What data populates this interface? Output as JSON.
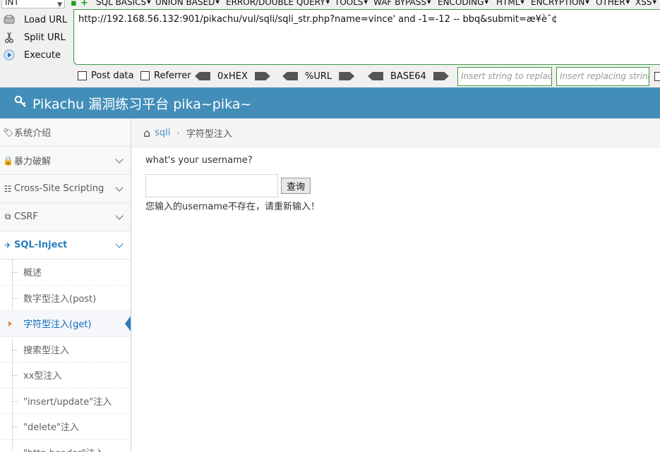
{
  "hackbar": {
    "select_value": "INT",
    "plus_icon": "+",
    "menu": [
      "SQL BASICS",
      "UNION BASED",
      "ERROR/DOUBLE QUERY",
      "TOOLS",
      "WAF BYPASS",
      "ENCODING",
      "HTML",
      "ENCRYPTION",
      "OTHER",
      "XSS"
    ],
    "actions": {
      "load_url": "Load URL",
      "split_url": "Split URL",
      "execute": "Execute"
    },
    "url": "http://192.168.56.132:901/pikachu/vul/sqli/sqli_str.php?name=vince' and -1=-12 -- bbq&submit=æ¥è¯¢",
    "post_data": "Post data",
    "referrer": "Referrer",
    "encoders": [
      "0xHEX",
      "%URL",
      "BASE64"
    ],
    "insert_string_placeholder": "Insert string to replace",
    "insert_replacing_placeholder": "Insert replacing string"
  },
  "site": {
    "title": "Pikachu 漏洞练习平台 pika~pika~"
  },
  "sidebar": {
    "items": [
      {
        "label": "系统介绍",
        "icon": "tag-icon",
        "glyph": "🏷",
        "has_chevron": false
      },
      {
        "label": "暴力破解",
        "icon": "lock-icon",
        "glyph": "🔒",
        "has_chevron": true
      },
      {
        "label": "Cross-Site Scripting",
        "icon": "list-tree-icon",
        "glyph": "☷",
        "has_chevron": true
      },
      {
        "label": "CSRF",
        "icon": "external-link-icon",
        "glyph": "⧉",
        "has_chevron": true
      },
      {
        "label": "SQL-Inject",
        "icon": "plane-icon",
        "glyph": "✈",
        "has_chevron": true,
        "active": true
      }
    ],
    "sub_items": [
      "概述",
      "数字型注入(post)",
      "字符型注入(get)",
      "搜索型注入",
      "xx型注入",
      "\"insert/update\"注入",
      "\"delete\"注入",
      "\"http header\"注入"
    ],
    "active_sub": 2
  },
  "breadcrumb": {
    "home_icon": "⌂",
    "link": "sqli",
    "separator": "›",
    "current": "字符型注入"
  },
  "main": {
    "question": "what's your username?",
    "input_value": "",
    "button_label": "查询",
    "result": "您输入的username不存在，请重新输入！"
  }
}
